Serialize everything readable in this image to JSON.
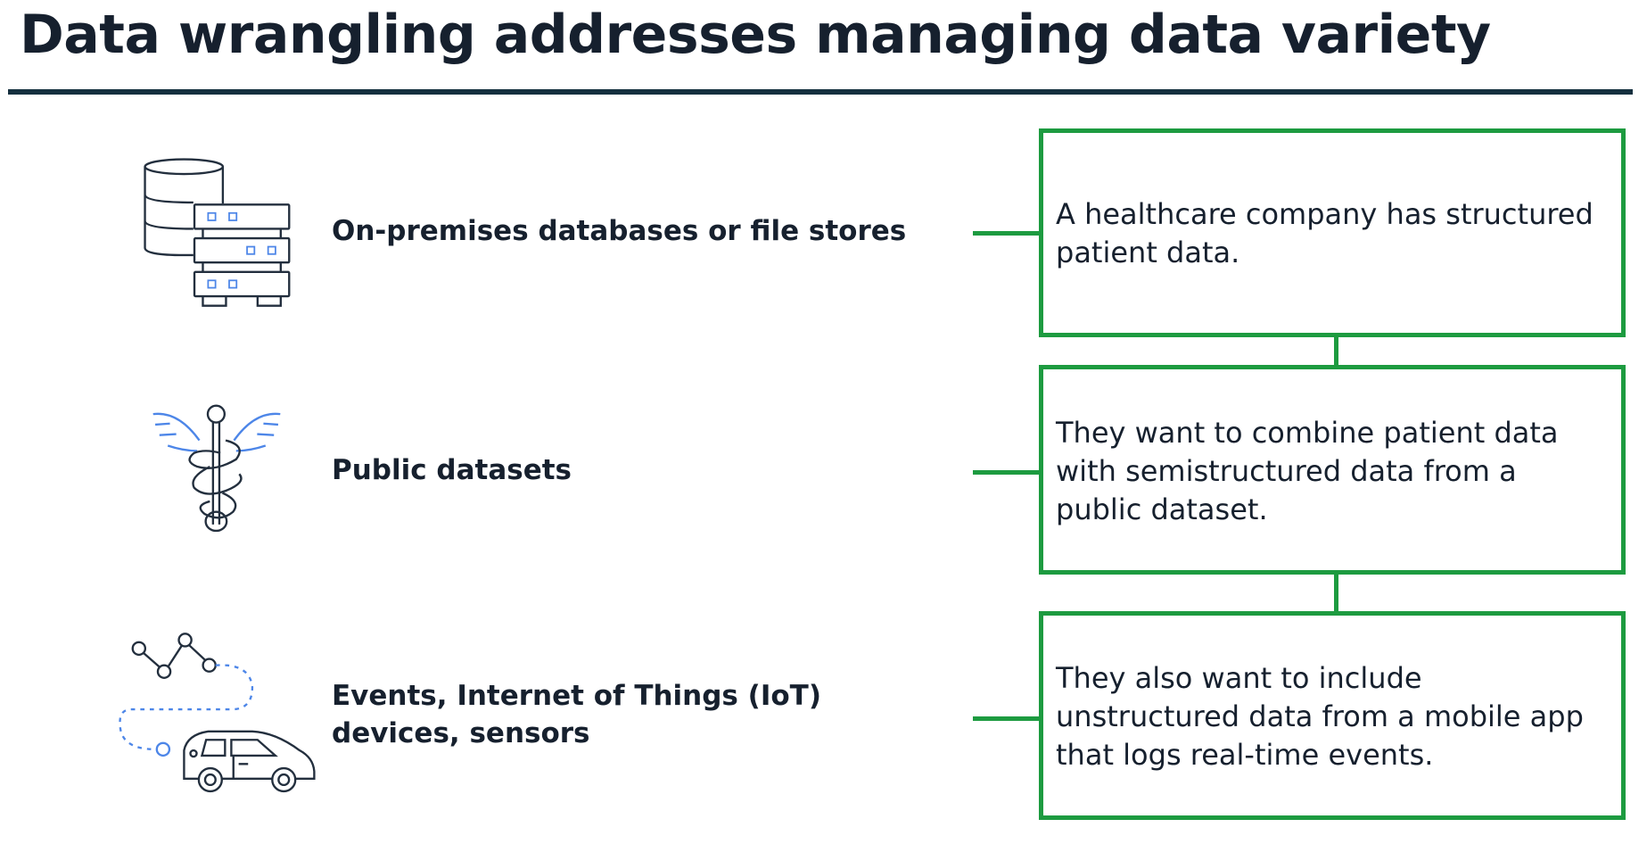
{
  "title": "Data wrangling addresses managing data variety",
  "sources": [
    {
      "icon": "database-server-icon",
      "label": "On-premises databases or file stores"
    },
    {
      "icon": "caduceus-icon",
      "label": "Public datasets"
    },
    {
      "icon": "iot-car-icon",
      "label_lines": [
        "Events, Internet of Things (IoT)",
        "devices, sensors"
      ]
    }
  ],
  "steps": [
    {
      "lines": [
        "A healthcare company has structured",
        "patient data."
      ]
    },
    {
      "lines": [
        "They want to combine patient data",
        "with semistructured data from a",
        "public dataset."
      ]
    },
    {
      "lines": [
        "They also want to include",
        "unstructured data from a mobile app",
        "that logs real-time events."
      ]
    }
  ],
  "colors": {
    "accent_green": "#1d9b40",
    "rule": "#15303f",
    "icon_blue": "#4d86e8",
    "text": "#16202e"
  }
}
